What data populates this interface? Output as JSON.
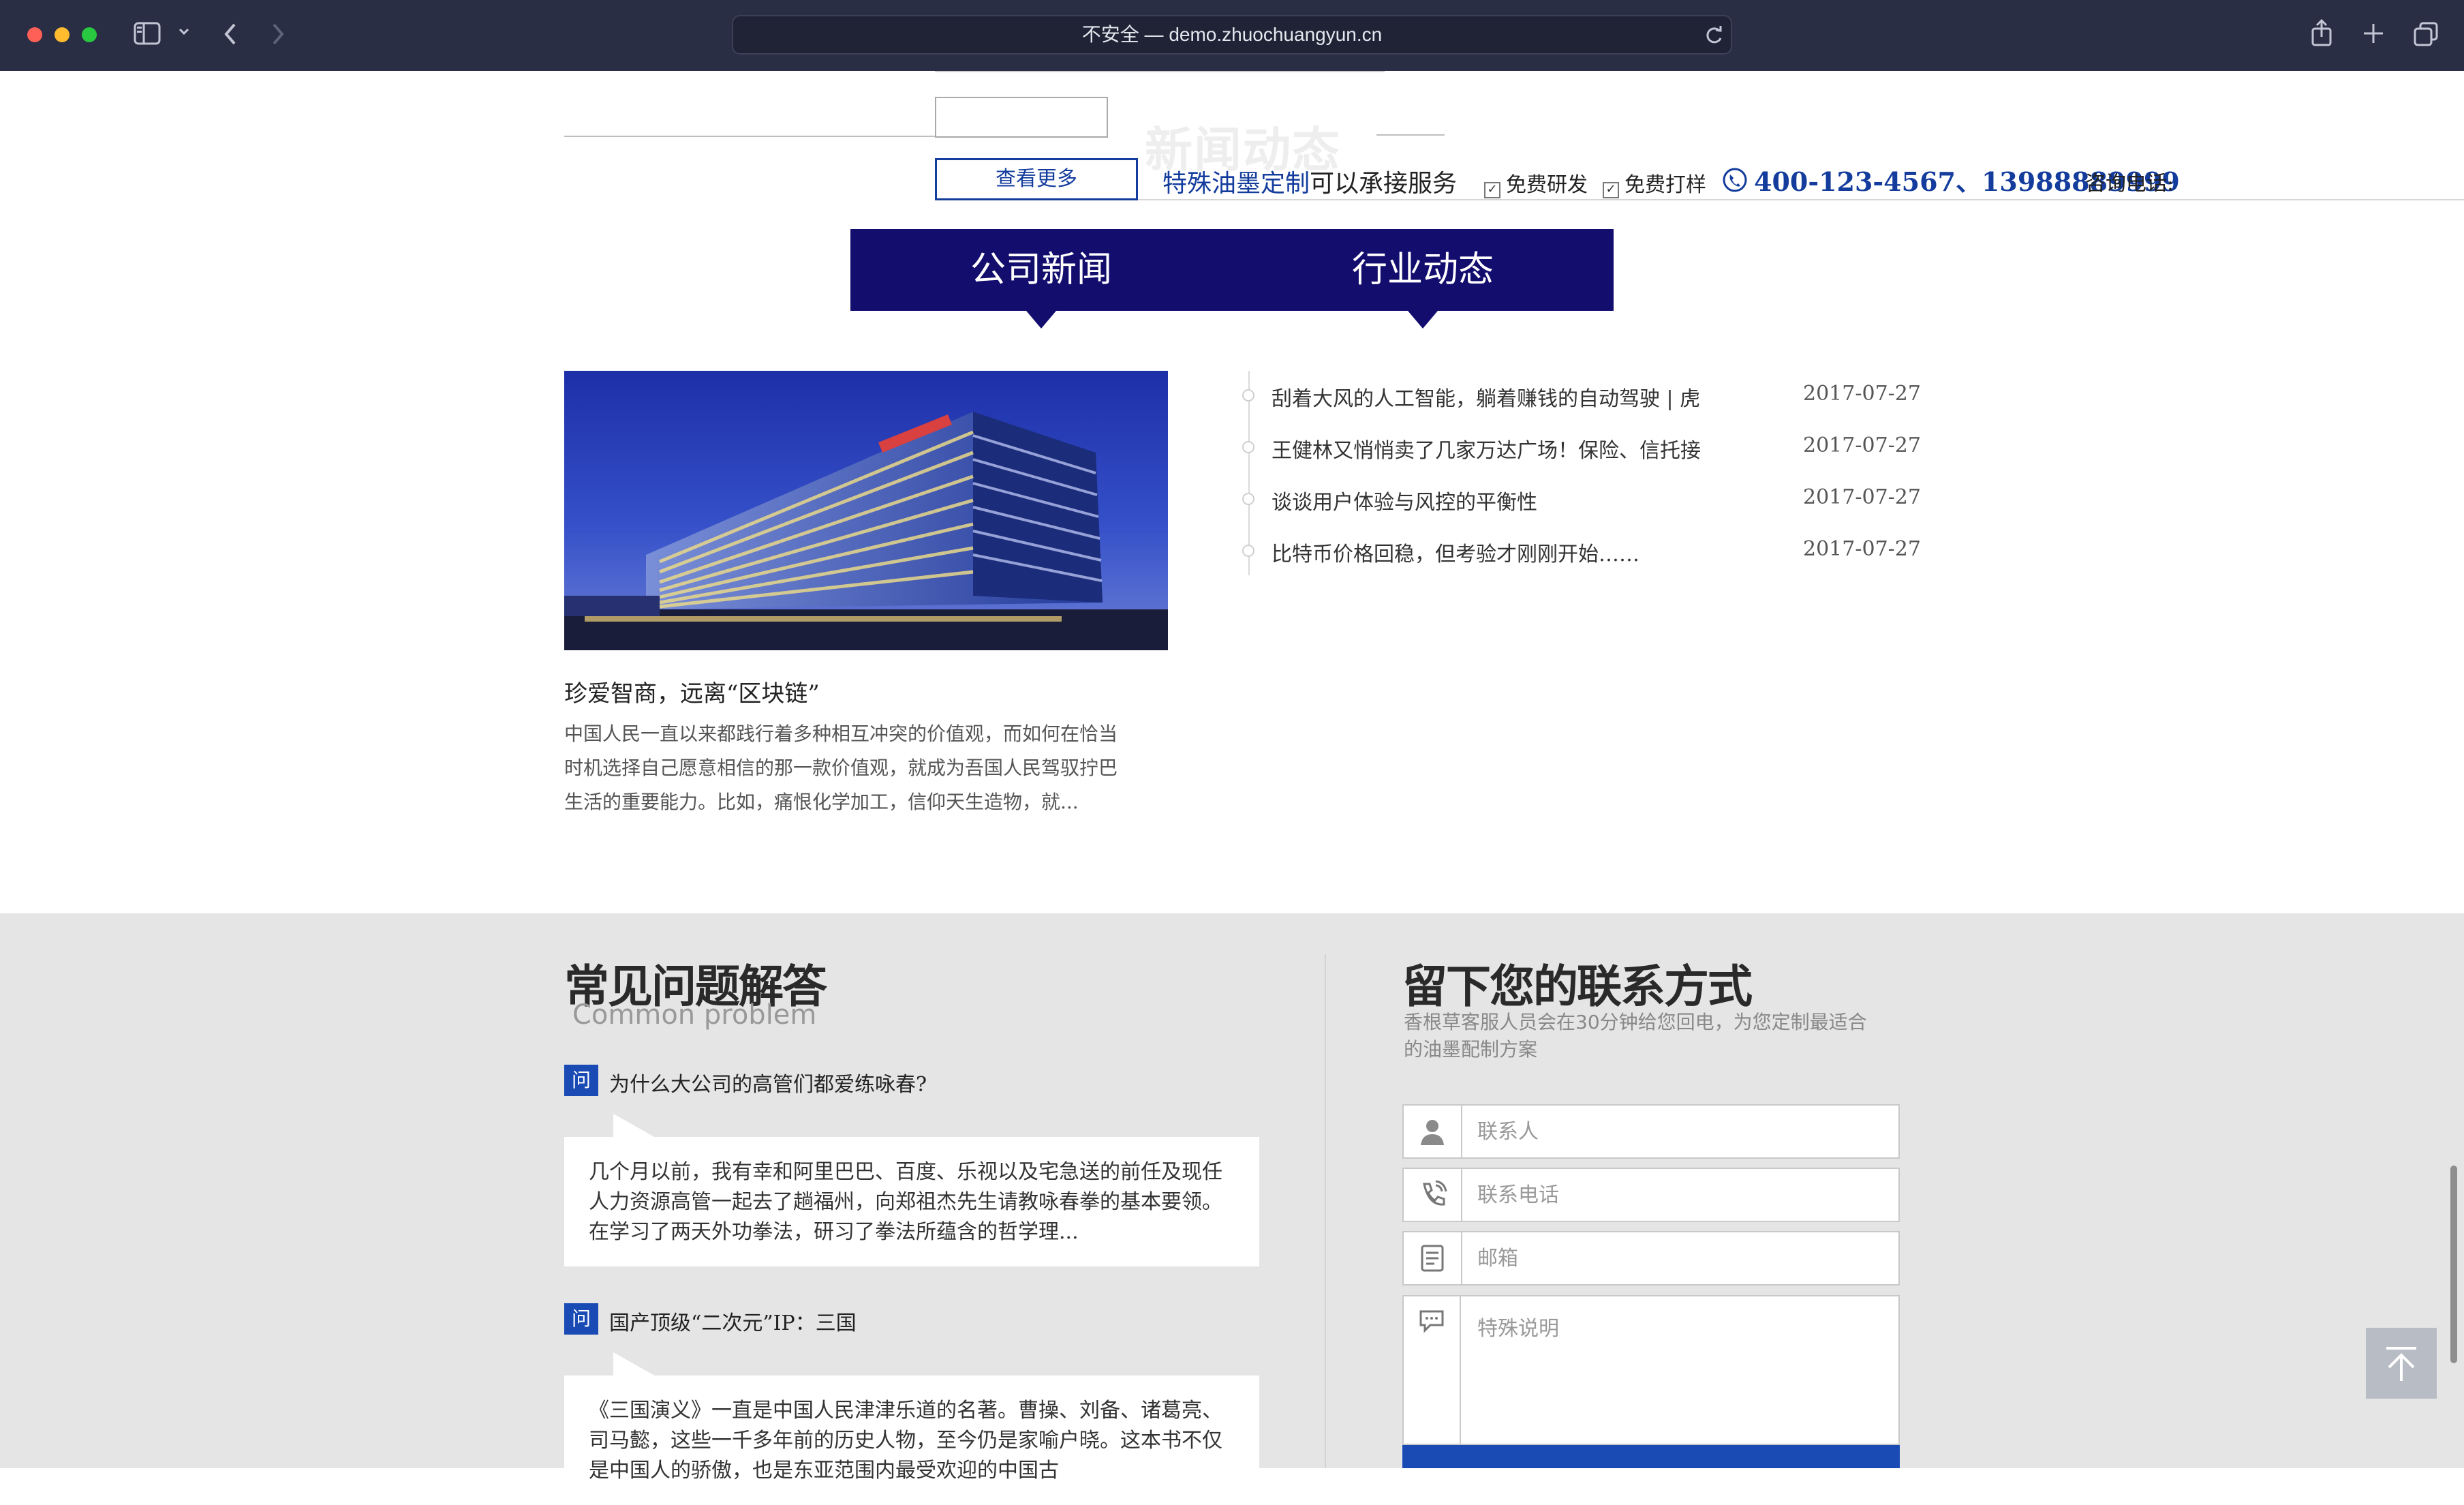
{
  "browser": {
    "url_text": "不安全 — demo.zhuochuangyun.cn"
  },
  "top": {
    "watermark": "新闻动态",
    "more_button": "查看更多",
    "tagline_blue": "特殊油墨定制",
    "tagline_rest": "可以承接服务",
    "checks": [
      "免费研发",
      "免费打样"
    ],
    "phone": "400-123-4567、13988889999",
    "phone_label": "咨询电话:"
  },
  "tabs": [
    {
      "label": "公司新闻"
    },
    {
      "label": "行业动态"
    }
  ],
  "featured": {
    "title": "珍爱智商，远离“区块链”",
    "summary_lines": [
      "中国人民一直以来都践行着多种相互冲突的价值观，而如何在恰当",
      "时机选择自己愿意相信的那一款价值观，就成为吾国人民驾驭拧巴",
      "生活的重要能力。比如，痛恨化学加工，信仰天生造物，就..."
    ]
  },
  "news_list": [
    {
      "title": "刮着大风的人工智能，躺着赚钱的自动驾驶 | 虎",
      "date": "2017-07-27"
    },
    {
      "title": "王健林又悄悄卖了几家万达广场！保险、信托接",
      "date": "2017-07-27"
    },
    {
      "title": "谈谈用户体验与风控的平衡性",
      "date": "2017-07-27"
    },
    {
      "title": "比特币价格回稳，但考验才刚刚开始……",
      "date": "2017-07-27"
    }
  ],
  "faq": {
    "title": "常见问题解答",
    "subtitle": "Common problem",
    "badge": "问",
    "items": [
      {
        "question": "为什么大公司的高管们都爱练咏春?",
        "answer_lines": [
          "几个月以前，我有幸和阿里巴巴、百度、乐视以及宅急送的前任及现任",
          "人力资源高管一起去了趟福州，向郑祖杰先生请教咏春拳的基本要领。",
          "在学习了两天外功拳法，研习了拳法所蕴含的哲学理..."
        ]
      },
      {
        "question": "国产顶级“二次元”IP：三国",
        "answer_lines": [
          "《三国演义》一直是中国人民津津乐道的名著。曹操、刘备、诸葛亮、",
          "司马懿，这些一千多年前的历史人物，至今仍是家喻户晓。这本书不仅",
          "是中国人的骄傲，也是东亚范围内最受欢迎的中国古"
        ]
      }
    ]
  },
  "contact": {
    "title": "留下您的联系方式",
    "desc_lines": [
      "香根草客服人员会在30分钟给您回电，为您定制最适合",
      "的油墨配制方案"
    ],
    "fields": [
      {
        "placeholder": "联系人",
        "icon": "person-icon"
      },
      {
        "placeholder": "联系电话",
        "icon": "phone-icon"
      },
      {
        "placeholder": "邮箱",
        "icon": "document-icon"
      },
      {
        "placeholder": "特殊说明",
        "icon": "chat-icon"
      }
    ]
  },
  "colors": {
    "tab_bg": "#130d6e",
    "accent_blue": "#133c9c",
    "badge_blue": "#1a4bb5",
    "section_gray": "#e5e5e5"
  }
}
